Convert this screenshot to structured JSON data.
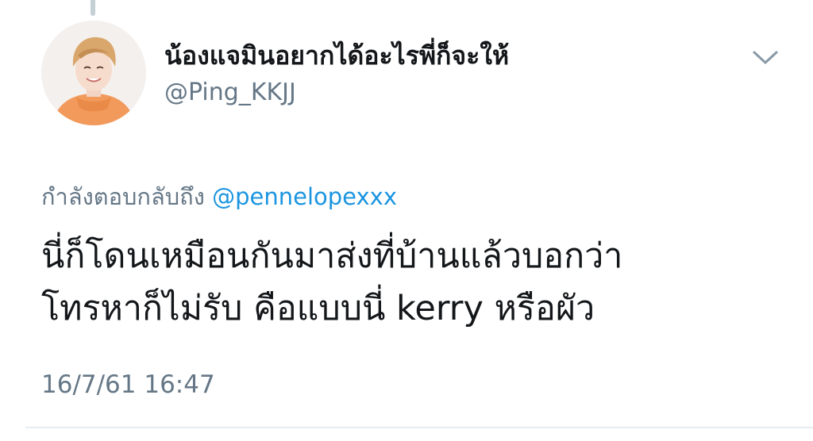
{
  "tweet": {
    "author": {
      "display_name": "น้องแจมินอยากได้อะไรพี่ก็จะให้",
      "handle": "@Ping_KKJJ"
    },
    "reply_to": {
      "prefix": "กำลังตอบกลับถึง",
      "mention": "@pennelopexxx"
    },
    "text_lines": [
      "นี่ก็โดนเหมือนกันมาส่งที่บ้านแล้วบอกว่า",
      "โทรหาก็ไม่รับ คือแบบนี่  kerry หรือผัว"
    ],
    "timestamp": "16/7/61 16:47",
    "icons": {
      "menu": "chevron-down-icon",
      "avatar": "avatar"
    }
  },
  "colors": {
    "text_primary": "#14171a",
    "text_secondary": "#657786",
    "link": "#1b95e0",
    "divider": "#e6ecf0",
    "avatar_hoodie": "#f29a5c"
  }
}
